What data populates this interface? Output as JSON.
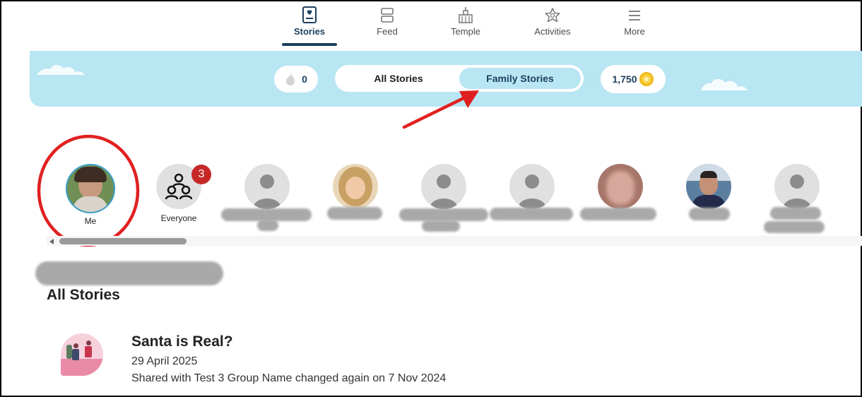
{
  "nav": [
    {
      "label": "Stories",
      "icon": "stories-icon",
      "active": true
    },
    {
      "label": "Feed",
      "icon": "feed-icon",
      "active": false
    },
    {
      "label": "Temple",
      "icon": "temple-icon",
      "active": false
    },
    {
      "label": "Activities",
      "icon": "activities-icon",
      "active": false
    },
    {
      "label": "More",
      "icon": "more-icon",
      "active": false
    }
  ],
  "banner": {
    "flame_count": "0",
    "toggle": {
      "all": "All Stories",
      "family": "Family Stories",
      "selected": "Family Stories"
    },
    "coins": "1,750"
  },
  "people": [
    {
      "name": "Me",
      "selected": true
    },
    {
      "name": "Everyone",
      "badge": "3"
    },
    {
      "name": ""
    },
    {
      "name": ""
    },
    {
      "name": ""
    },
    {
      "name": ""
    },
    {
      "name": ""
    },
    {
      "name": ""
    },
    {
      "name": ""
    }
  ],
  "section_title": "All Stories",
  "story": {
    "title": "Santa is Real?",
    "date": "29 April 2025",
    "shared": "Shared with Test 3 Group Name changed again on 7 Nov 2024"
  },
  "colors": {
    "brand": "#1d3f5e",
    "banner": "#b9e6f3",
    "annotation": "#e02020",
    "badge": "#c62828"
  }
}
